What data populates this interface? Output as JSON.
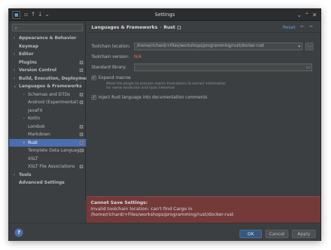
{
  "window": {
    "title": "Settings"
  },
  "search": {
    "placeholder": ""
  },
  "sidebar": {
    "items": [
      {
        "label": "Appearance & Behavior"
      },
      {
        "label": "Keymap"
      },
      {
        "label": "Editor"
      },
      {
        "label": "Plugins"
      },
      {
        "label": "Version Control"
      },
      {
        "label": "Build, Execution, Deployment"
      },
      {
        "label": "Languages & Frameworks"
      },
      {
        "label": "Schemas and DTDs"
      },
      {
        "label": "Android (Experimental)"
      },
      {
        "label": "JavaFX"
      },
      {
        "label": "Kotlin"
      },
      {
        "label": "Lombok"
      },
      {
        "label": "Markdown"
      },
      {
        "label": "Rust"
      },
      {
        "label": "Template Data Languages"
      },
      {
        "label": "XSLT"
      },
      {
        "label": "XSLT File Associations"
      },
      {
        "label": "Tools"
      },
      {
        "label": "Advanced Settings"
      }
    ]
  },
  "header": {
    "crumb_parent": "Languages & Frameworks",
    "crumb_sep": "›",
    "crumb_current": "Rust",
    "reset_label": "Reset"
  },
  "form": {
    "toolchain_location_label": "Toolchain location:",
    "toolchain_location_value": "/home/richard/+Files/workshops/programming/rust/docker-rust",
    "toolchain_version_label": "Toolchain version:",
    "toolchain_version_value": "N/A",
    "standard_library_label": "Standard library:",
    "standard_library_value": "",
    "browse_label": "...",
    "expand_macros_label": "Expand macros",
    "expand_macros_checked": true,
    "expand_macros_hint_1": "Allow the plugin to process macro invocations to extract information",
    "expand_macros_hint_2": "for name resolution and type inference",
    "inject_rust_label": "Inject Rust language into documentation comments",
    "inject_rust_checked": true
  },
  "error": {
    "title": "Cannot Save Settings:",
    "message": "Invalid toolchain location: can't find Cargo in",
    "path": "/home/richard/+Files/workshops/programming/rust/docker-rust"
  },
  "footer": {
    "help_label": "?",
    "ok_label": "OK",
    "cancel_label": "Cancel",
    "apply_label": "Apply"
  },
  "colors": {
    "background": "#3c3f41",
    "selection": "#4b6eaf",
    "link": "#589df6",
    "error_bg": "#743a3a",
    "error_text": "#e06c5a",
    "primary_button": "#365880"
  }
}
